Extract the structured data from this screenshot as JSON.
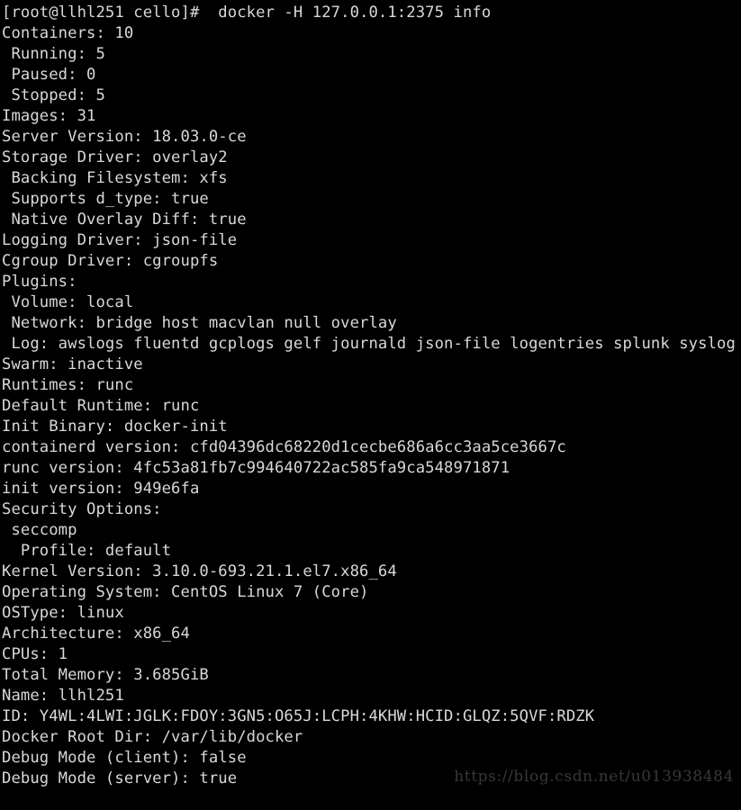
{
  "terminal": {
    "background_color": "#000000",
    "foreground_color": "#d9d9d9",
    "prompt": "[root@llhl251 cello]#  docker -H 127.0.0.1:2375 info",
    "lines": [
      "Containers: 10",
      " Running: 5",
      " Paused: 0",
      " Stopped: 5",
      "Images: 31",
      "Server Version: 18.03.0-ce",
      "Storage Driver: overlay2",
      " Backing Filesystem: xfs",
      " Supports d_type: true",
      " Native Overlay Diff: true",
      "Logging Driver: json-file",
      "Cgroup Driver: cgroupfs",
      "Plugins:",
      " Volume: local",
      " Network: bridge host macvlan null overlay",
      " Log: awslogs fluentd gcplogs gelf journald json-file logentries splunk syslog",
      "Swarm: inactive",
      "Runtimes: runc",
      "Default Runtime: runc",
      "Init Binary: docker-init",
      "containerd version: cfd04396dc68220d1cecbe686a6cc3aa5ce3667c",
      "runc version: 4fc53a81fb7c994640722ac585fa9ca548971871",
      "init version: 949e6fa",
      "Security Options:",
      " seccomp",
      "  Profile: default",
      "Kernel Version: 3.10.0-693.21.1.el7.x86_64",
      "Operating System: CentOS Linux 7 (Core)",
      "OSType: linux",
      "Architecture: x86_64",
      "CPUs: 1",
      "Total Memory: 3.685GiB",
      "Name: llhl251",
      "ID: Y4WL:4LWI:JGLK:FDOY:3GN5:O65J:LCPH:4KHW:HCID:GLQZ:5QVF:RDZK",
      "Docker Root Dir: /var/lib/docker",
      "Debug Mode (client): false",
      "Debug Mode (server): true"
    ]
  },
  "watermark": {
    "text": "https://blog.csdn.net/u013938484",
    "color": "#38383a"
  }
}
